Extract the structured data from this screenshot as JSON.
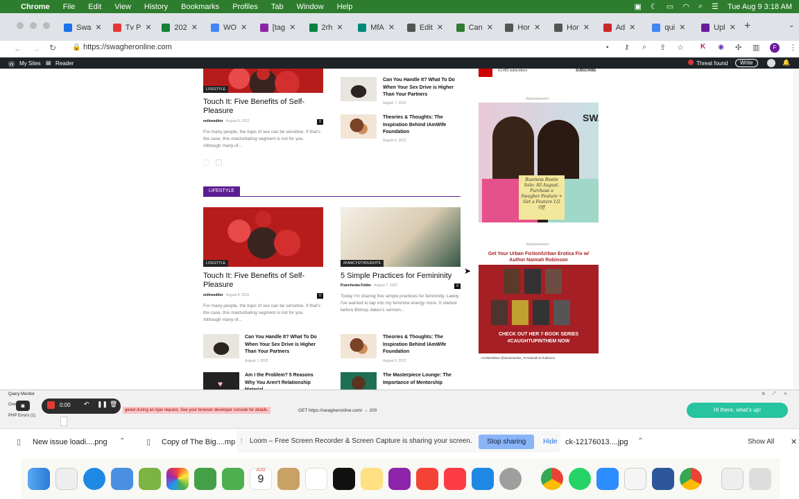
{
  "menubar": {
    "app": "Chrome",
    "items": [
      "File",
      "Edit",
      "View",
      "History",
      "Bookmarks",
      "Profiles",
      "Tab",
      "Window",
      "Help"
    ],
    "datetime": "Tue Aug 9  3:18 AM"
  },
  "tabs": [
    {
      "label": "Swa",
      "color": "#1a73e8"
    },
    {
      "label": "Tv P",
      "color": "#e53935"
    },
    {
      "label": "202",
      "color": "#188038"
    },
    {
      "label": "WO",
      "color": "#4285f4"
    },
    {
      "label": "[tag",
      "color": "#8e24aa"
    },
    {
      "label": "2rh",
      "color": "#0b8043"
    },
    {
      "label": "MfA",
      "color": "#00897b"
    },
    {
      "label": "Edit",
      "color": "#555555"
    },
    {
      "label": "Can",
      "color": "#2e7d32"
    },
    {
      "label": "Hor",
      "color": "#555555"
    },
    {
      "label": "Hor",
      "color": "#555555"
    },
    {
      "label": "Ad",
      "color": "#c62828"
    },
    {
      "label": "qui",
      "color": "#4285f4"
    },
    {
      "label": "Upl",
      "color": "#6a1b9a"
    }
  ],
  "address": {
    "url": "https://swagheronline.com"
  },
  "wpbar": {
    "my_sites": "My Sites",
    "reader": "Reader",
    "threat": "Threat found",
    "write": "Write"
  },
  "top_block": {
    "category": "LIFESTYLE",
    "title": "Touch It: Five Benefits of Self-Pleasure",
    "author": "onlineeditor",
    "date": "August 8, 2022",
    "comments": "0",
    "excerpt": "For many people, the topic of sex can be sensitive. If that's the case, this masturbating segment is not for you. Although many of...",
    "side_items": [
      {
        "title": "Can You Handle It? What To Do When Your Sex Drive is Higher Than Your Partners",
        "date": "August 7, 2022"
      },
      {
        "title": "Theories & Thoughts: The Inspiration Behind IAmWife Foundation",
        "date": "August 6, 2022"
      }
    ]
  },
  "section": {
    "heading": "LIFESTYLE",
    "accent": "#5b1e91",
    "posts": [
      {
        "category": "LIFESTYLE",
        "title": "Touch It: Five Benefits of Self-Pleasure",
        "author": "onlineeditor",
        "date": "August 8, 2022",
        "comments": "0",
        "excerpt": "For many people, the topic of sex can be sensitive. If that's the case, this masturbating segment is not for you. Although many of..."
      },
      {
        "category": "#FANCYSTHOUGHTS",
        "title": "5 Simple Practices for Femininity",
        "author": "Francheska Felder",
        "date": "August 7, 2022",
        "comments": "0",
        "excerpt": "Today I'm sharing five simple practices for femininity. Lately, I've wanted to tap into my feminine energy more. It started before Bishop Jakes's sermon..."
      }
    ],
    "left_list": [
      {
        "title": "Can You Handle It? What To Do When Your Sex Drive is Higher Than Your Partners",
        "date": "August 7, 2022"
      },
      {
        "title": "Am I the Problem? 5 Reasons Why You Aren't Relationship Material",
        "date": ""
      }
    ],
    "right_list": [
      {
        "title": "Theories & Thoughts: The Inspiration Behind IAmWife Foundation",
        "date": "August 6, 2022"
      },
      {
        "title": "The Masterpiece Lounge: The Importance of Mentorship",
        "date": ""
      }
    ]
  },
  "sidebar": {
    "youtube": {
      "subscribers": "61,453 subscribers",
      "subscribe": "SUBSCRIBE"
    },
    "ad_label": "- Advertisement -",
    "ad1": {
      "brand": "SWAG",
      "text": "Business Bestie Sale: All August. Purchase a Swagher Feature + Get a Feature 1/2 Off"
    },
    "ad2": {
      "headline": "Get Your Urban Fiction/Urban Erotica Fix w/ Author Naimah Robinson",
      "cta": "CHECK OUT HER 7-BOOK SERIES #CAUGHTUPINTHEM NOW",
      "handles": "IAmNimiElise  @iamnimielise_79  Naimah E Robinson"
    }
  },
  "query_monitor": {
    "title": "Query Monitor",
    "tab_overview": "Ove",
    "tab_php": "PHP Errors (1)",
    "error": "gered during an Ajax request. See your browser developer console for details.",
    "request": "GET https://swagheronline.com/ → 200",
    "timer": "0:00",
    "toast": "Hi there, what's up!"
  },
  "downloads": {
    "items": [
      "New issue loadi....png",
      "Copy of The Big....mp",
      "ck-12176013....jpg"
    ],
    "share_msg": "Loom – Free Screen Recorder & Screen Capture is sharing your screen.",
    "stop": "Stop sharing",
    "hide": "Hide",
    "show_all": "Show All"
  },
  "dock": {
    "calendar_month": "AUG",
    "calendar_day": "9"
  }
}
